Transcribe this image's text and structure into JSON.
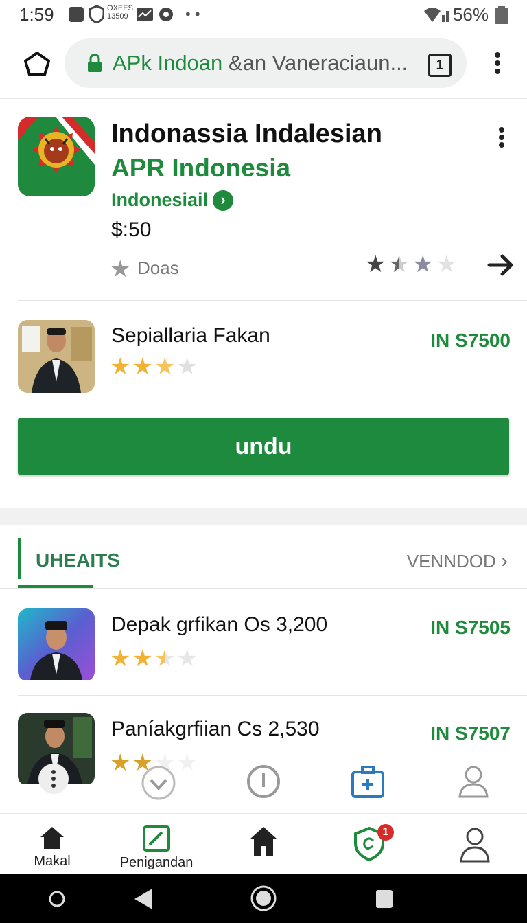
{
  "status": {
    "time": "1:59",
    "battery": "56%",
    "mini_top": "OXEES",
    "mini_bottom": "13509"
  },
  "browser": {
    "url_green": "APk Indoan",
    "url_rest": " &an Vaneraciaun...",
    "tab_count": "1"
  },
  "app": {
    "title": "Indonassia Indalesian",
    "subtitle": "APR Indonesia",
    "developer": "Indonesiail",
    "price": "$:50",
    "downloads_label": "Doas",
    "rating": 1.5
  },
  "featured": {
    "name": "Sepiallaria Fakan",
    "price": "IN S7500",
    "rating": 3
  },
  "install_button": "undu",
  "section": {
    "tab": "UHEAITS",
    "view_more": "VENNDOD"
  },
  "list": [
    {
      "name": "Depak grfikan Os 3,200",
      "price": "IN S7505",
      "rating": 2.5
    },
    {
      "name": "Paníakgrfiian Cs 2,530",
      "price": "IN S7507",
      "rating": 2
    }
  ],
  "bottom_nav": [
    {
      "label": "Makal",
      "icon": "home-icon"
    },
    {
      "label": "Penigandan",
      "icon": "edit-icon"
    },
    {
      "label": "",
      "icon": "home-icon"
    },
    {
      "label": "",
      "icon": "shield-icon",
      "badge": "1"
    },
    {
      "label": "",
      "icon": "person-icon"
    }
  ],
  "colors": {
    "accent": "#1e8a3c",
    "star_gold": "#f2b233",
    "star_dark": "#444444"
  }
}
